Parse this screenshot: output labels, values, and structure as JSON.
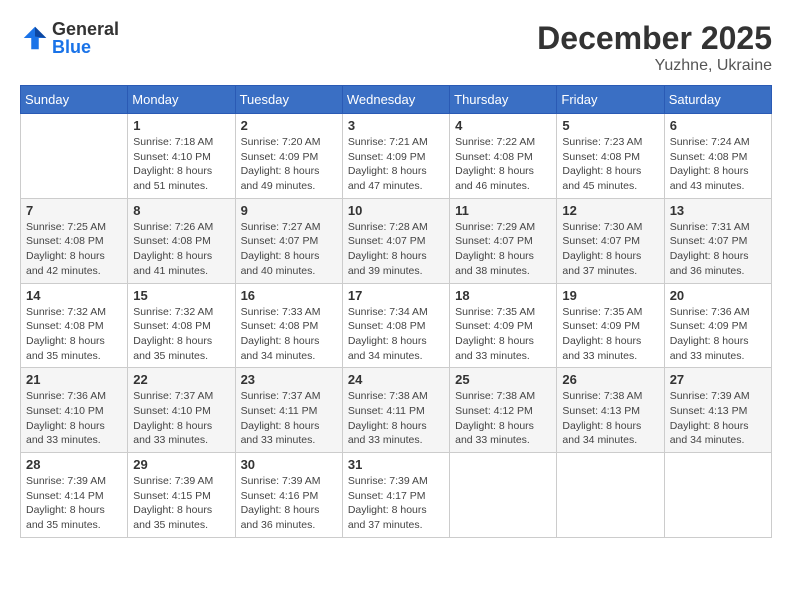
{
  "logo": {
    "general": "General",
    "blue": "Blue"
  },
  "title": {
    "month": "December 2025",
    "location": "Yuzhne, Ukraine"
  },
  "weekdays": [
    "Sunday",
    "Monday",
    "Tuesday",
    "Wednesday",
    "Thursday",
    "Friday",
    "Saturday"
  ],
  "weeks": [
    [
      {
        "day": "",
        "info": ""
      },
      {
        "day": "1",
        "info": "Sunrise: 7:18 AM\nSunset: 4:10 PM\nDaylight: 8 hours\nand 51 minutes."
      },
      {
        "day": "2",
        "info": "Sunrise: 7:20 AM\nSunset: 4:09 PM\nDaylight: 8 hours\nand 49 minutes."
      },
      {
        "day": "3",
        "info": "Sunrise: 7:21 AM\nSunset: 4:09 PM\nDaylight: 8 hours\nand 47 minutes."
      },
      {
        "day": "4",
        "info": "Sunrise: 7:22 AM\nSunset: 4:08 PM\nDaylight: 8 hours\nand 46 minutes."
      },
      {
        "day": "5",
        "info": "Sunrise: 7:23 AM\nSunset: 4:08 PM\nDaylight: 8 hours\nand 45 minutes."
      },
      {
        "day": "6",
        "info": "Sunrise: 7:24 AM\nSunset: 4:08 PM\nDaylight: 8 hours\nand 43 minutes."
      }
    ],
    [
      {
        "day": "7",
        "info": "Sunrise: 7:25 AM\nSunset: 4:08 PM\nDaylight: 8 hours\nand 42 minutes."
      },
      {
        "day": "8",
        "info": "Sunrise: 7:26 AM\nSunset: 4:08 PM\nDaylight: 8 hours\nand 41 minutes."
      },
      {
        "day": "9",
        "info": "Sunrise: 7:27 AM\nSunset: 4:07 PM\nDaylight: 8 hours\nand 40 minutes."
      },
      {
        "day": "10",
        "info": "Sunrise: 7:28 AM\nSunset: 4:07 PM\nDaylight: 8 hours\nand 39 minutes."
      },
      {
        "day": "11",
        "info": "Sunrise: 7:29 AM\nSunset: 4:07 PM\nDaylight: 8 hours\nand 38 minutes."
      },
      {
        "day": "12",
        "info": "Sunrise: 7:30 AM\nSunset: 4:07 PM\nDaylight: 8 hours\nand 37 minutes."
      },
      {
        "day": "13",
        "info": "Sunrise: 7:31 AM\nSunset: 4:07 PM\nDaylight: 8 hours\nand 36 minutes."
      }
    ],
    [
      {
        "day": "14",
        "info": "Sunrise: 7:32 AM\nSunset: 4:08 PM\nDaylight: 8 hours\nand 35 minutes."
      },
      {
        "day": "15",
        "info": "Sunrise: 7:32 AM\nSunset: 4:08 PM\nDaylight: 8 hours\nand 35 minutes."
      },
      {
        "day": "16",
        "info": "Sunrise: 7:33 AM\nSunset: 4:08 PM\nDaylight: 8 hours\nand 34 minutes."
      },
      {
        "day": "17",
        "info": "Sunrise: 7:34 AM\nSunset: 4:08 PM\nDaylight: 8 hours\nand 34 minutes."
      },
      {
        "day": "18",
        "info": "Sunrise: 7:35 AM\nSunset: 4:09 PM\nDaylight: 8 hours\nand 33 minutes."
      },
      {
        "day": "19",
        "info": "Sunrise: 7:35 AM\nSunset: 4:09 PM\nDaylight: 8 hours\nand 33 minutes."
      },
      {
        "day": "20",
        "info": "Sunrise: 7:36 AM\nSunset: 4:09 PM\nDaylight: 8 hours\nand 33 minutes."
      }
    ],
    [
      {
        "day": "21",
        "info": "Sunrise: 7:36 AM\nSunset: 4:10 PM\nDaylight: 8 hours\nand 33 minutes."
      },
      {
        "day": "22",
        "info": "Sunrise: 7:37 AM\nSunset: 4:10 PM\nDaylight: 8 hours\nand 33 minutes."
      },
      {
        "day": "23",
        "info": "Sunrise: 7:37 AM\nSunset: 4:11 PM\nDaylight: 8 hours\nand 33 minutes."
      },
      {
        "day": "24",
        "info": "Sunrise: 7:38 AM\nSunset: 4:11 PM\nDaylight: 8 hours\nand 33 minutes."
      },
      {
        "day": "25",
        "info": "Sunrise: 7:38 AM\nSunset: 4:12 PM\nDaylight: 8 hours\nand 33 minutes."
      },
      {
        "day": "26",
        "info": "Sunrise: 7:38 AM\nSunset: 4:13 PM\nDaylight: 8 hours\nand 34 minutes."
      },
      {
        "day": "27",
        "info": "Sunrise: 7:39 AM\nSunset: 4:13 PM\nDaylight: 8 hours\nand 34 minutes."
      }
    ],
    [
      {
        "day": "28",
        "info": "Sunrise: 7:39 AM\nSunset: 4:14 PM\nDaylight: 8 hours\nand 35 minutes."
      },
      {
        "day": "29",
        "info": "Sunrise: 7:39 AM\nSunset: 4:15 PM\nDaylight: 8 hours\nand 35 minutes."
      },
      {
        "day": "30",
        "info": "Sunrise: 7:39 AM\nSunset: 4:16 PM\nDaylight: 8 hours\nand 36 minutes."
      },
      {
        "day": "31",
        "info": "Sunrise: 7:39 AM\nSunset: 4:17 PM\nDaylight: 8 hours\nand 37 minutes."
      },
      {
        "day": "",
        "info": ""
      },
      {
        "day": "",
        "info": ""
      },
      {
        "day": "",
        "info": ""
      }
    ]
  ]
}
